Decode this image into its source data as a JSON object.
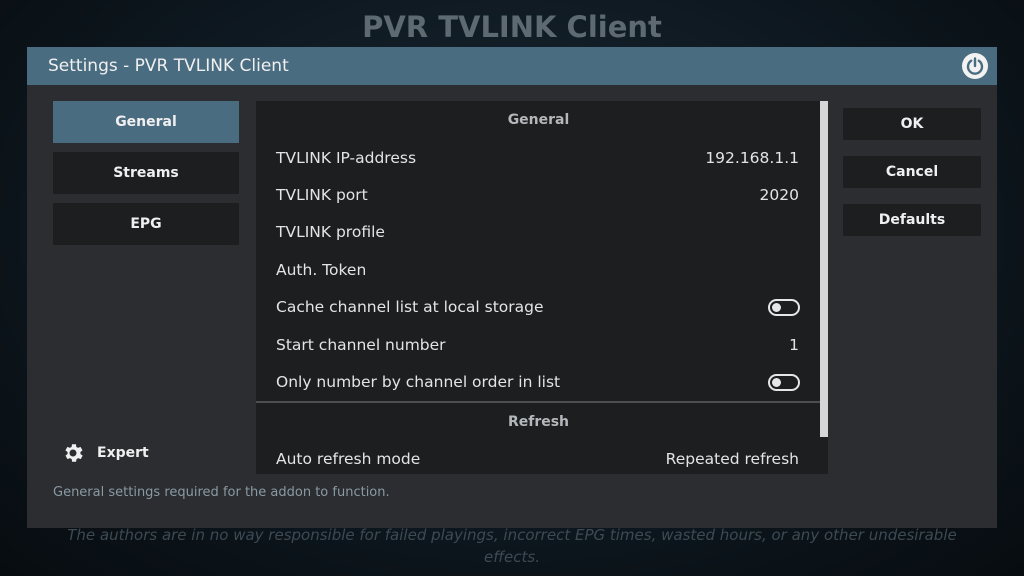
{
  "background": {
    "title": "PVR TVLINK Client"
  },
  "dialog": {
    "title": "Settings - PVR TVLINK Client",
    "power_icon": "power-icon",
    "nav": [
      {
        "label": "General",
        "active": true
      },
      {
        "label": "Streams",
        "active": false
      },
      {
        "label": "EPG",
        "active": false
      }
    ],
    "expert_label": "Expert",
    "expert_icon": "gear-icon",
    "sections": [
      {
        "header": "General",
        "rows": [
          {
            "label": "TVLINK IP-address",
            "value": "192.168.1.1"
          },
          {
            "label": "TVLINK port",
            "value": "2020"
          },
          {
            "label": "TVLINK profile",
            "value": ""
          },
          {
            "label": "Auth. Token",
            "value": ""
          },
          {
            "label": "Cache channel list at local storage",
            "toggle": false
          },
          {
            "label": "Start channel number",
            "value": "1"
          },
          {
            "label": "Only number by channel order in list",
            "toggle": false
          }
        ]
      },
      {
        "header": "Refresh",
        "rows": [
          {
            "label": "Auto refresh mode",
            "value": "Repeated refresh"
          }
        ]
      }
    ],
    "buttons": {
      "ok": "OK",
      "cancel": "Cancel",
      "defaults": "Defaults"
    },
    "help_text": "General settings required for the addon to function."
  },
  "disclaimer": "The authors are in no way responsible for failed playings, incorrect EPG times, wasted hours, or any other undesirable effects.",
  "colors": {
    "accent": "#4a6c80",
    "panel": "#1c1e20",
    "dialog": "#2b2d30"
  }
}
